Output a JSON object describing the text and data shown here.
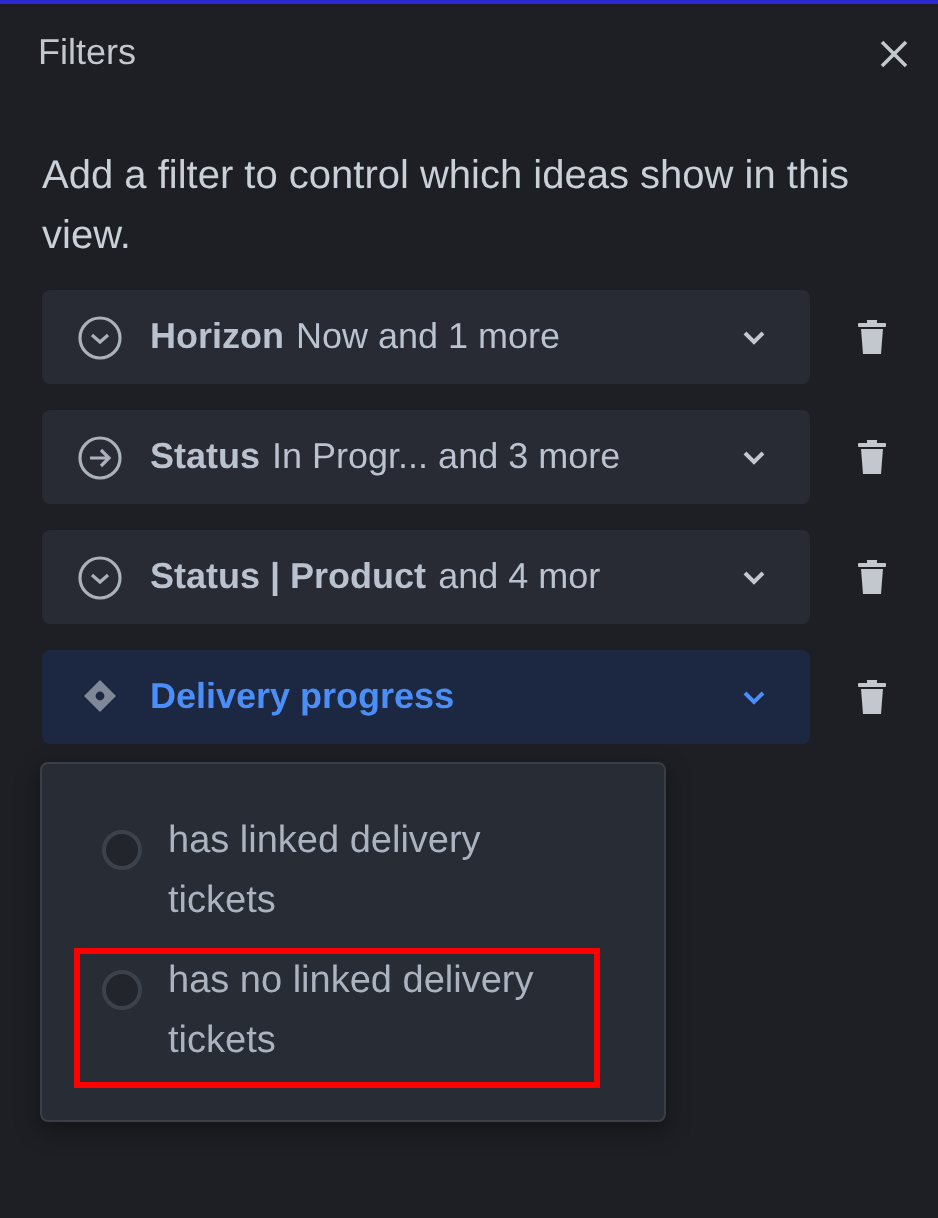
{
  "panel": {
    "title": "Filters",
    "description": "Add a filter to control which ideas show in this view."
  },
  "filters": [
    {
      "kind": "choice",
      "field": "Horizon",
      "value": "Now and 1 more",
      "selected": false
    },
    {
      "kind": "workflow",
      "field": "Status",
      "value": "In Progr... and 3 more",
      "selected": false
    },
    {
      "kind": "choice",
      "field": "Status | Product",
      "value": "and 4 mor",
      "selected": false
    },
    {
      "kind": "delivery",
      "field": "Delivery progress",
      "selected": true
    }
  ],
  "dropdown": {
    "options": [
      {
        "label": "has linked delivery tickets",
        "selected": false,
        "highlighted": false
      },
      {
        "label": "has no linked delivery tickets",
        "selected": false,
        "highlighted": true
      }
    ]
  }
}
